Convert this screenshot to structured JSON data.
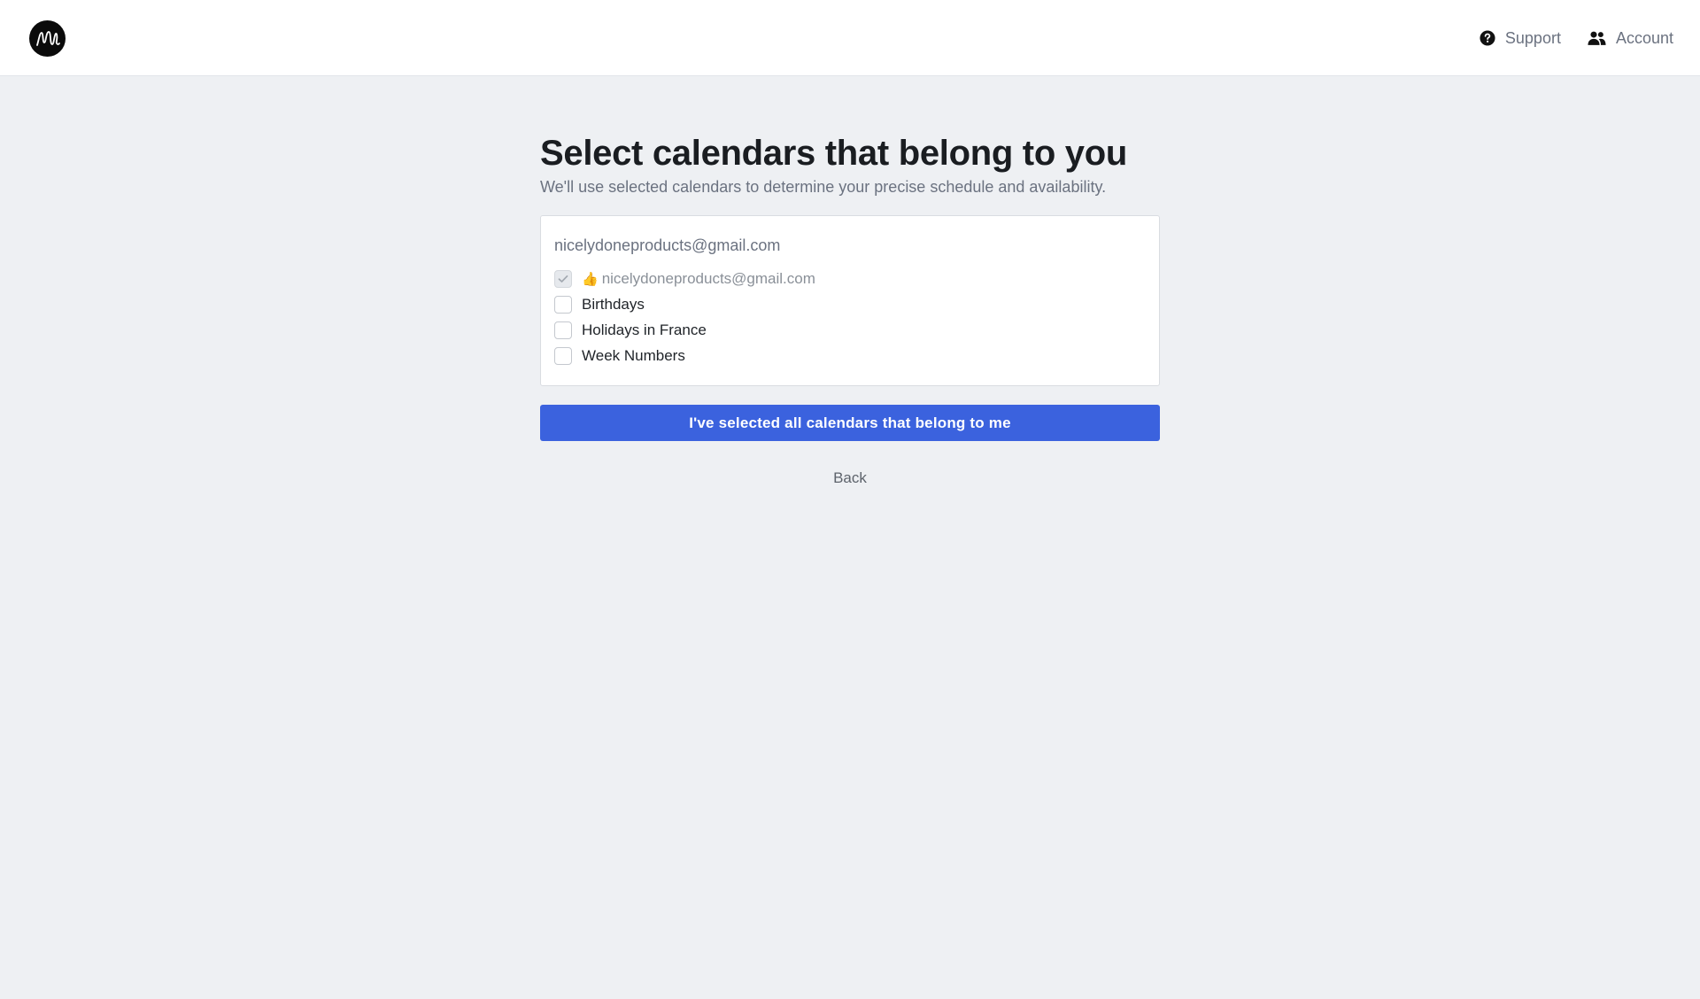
{
  "header": {
    "logo_icon": "scribble-m-logo",
    "nav": [
      {
        "icon": "question-circle-icon",
        "label": "Support"
      },
      {
        "icon": "users-icon",
        "label": "Account"
      }
    ]
  },
  "main": {
    "title": "Select calendars that belong to you",
    "subtitle": "We'll use selected calendars to determine your precise schedule and availability.",
    "account": {
      "email": "nicelydoneproducts@gmail.com",
      "calendars": [
        {
          "emoji": "👍",
          "label": "nicelydoneproducts@gmail.com",
          "checked": true,
          "disabled": true
        },
        {
          "label": "Birthdays",
          "checked": false
        },
        {
          "label": "Holidays in France",
          "checked": false
        },
        {
          "label": "Week Numbers",
          "checked": false
        }
      ]
    },
    "confirm_label": "I've selected all calendars that belong to me",
    "back_label": "Back"
  },
  "colors": {
    "primary": "#3b62de",
    "background": "#eef0f3"
  }
}
